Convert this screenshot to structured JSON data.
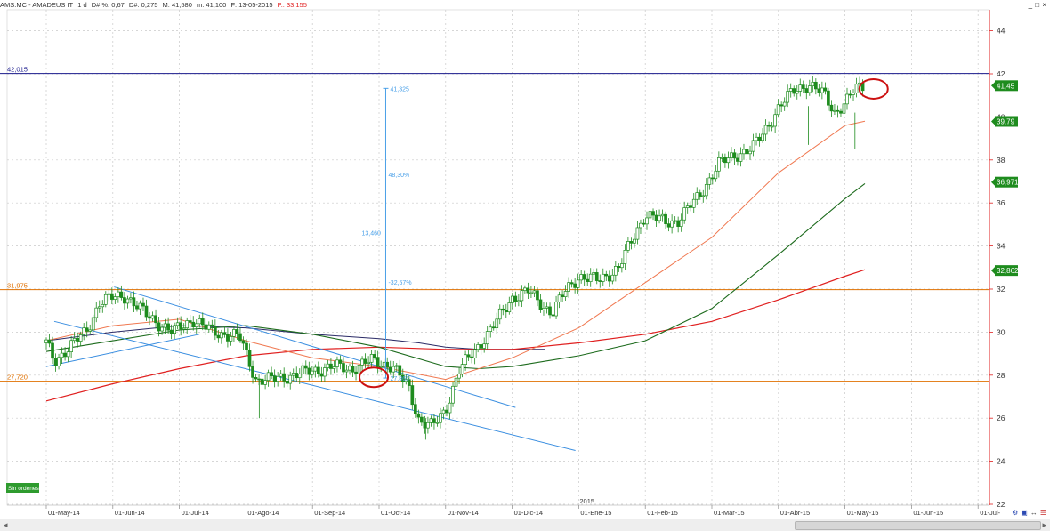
{
  "header": {
    "name": "AMS.MC - AMADEUS IT",
    "interval": "1 d",
    "change_pct": "D# %: 0,67",
    "change_abs": "D#: 0,275",
    "high": "M: 41,580",
    "low": "m: 41,100",
    "date": "F: 13-05-2015",
    "p_value": "P.: 33,155",
    "window_controls": [
      "_",
      "□",
      "×"
    ]
  },
  "chart_data": {
    "type": "candlestick",
    "x": [
      "01-May-14",
      "01-Jun-14",
      "01-Jul-14",
      "01-Ago-14",
      "01-Sep-14",
      "01-Oct-14",
      "01-Nov-14",
      "01-Dic-14",
      "01-Ene-15",
      "01-Feb-15",
      "01-Mar-15",
      "01-Abr-15",
      "01-May-15",
      "01-Jun-15",
      "01-Jul-"
    ],
    "year_marker": "2015",
    "y_ticks": [
      22,
      24,
      26,
      28,
      30,
      32,
      34,
      36,
      38,
      40,
      42,
      44
    ],
    "ylim": [
      22,
      45
    ],
    "price_path": [
      [
        0,
        29.5
      ],
      [
        0.12,
        28.6
      ],
      [
        0.3,
        29.2
      ],
      [
        0.6,
        30.0
      ],
      [
        0.8,
        31.4
      ],
      [
        1.0,
        31.6
      ],
      [
        1.2,
        31.7
      ],
      [
        1.5,
        30.8
      ],
      [
        1.9,
        30.0
      ],
      [
        2.2,
        30.6
      ],
      [
        2.5,
        30.0
      ],
      [
        2.9,
        29.8
      ],
      [
        3.15,
        27.8
      ],
      [
        3.4,
        27.8
      ],
      [
        3.7,
        28.0
      ],
      [
        4.0,
        28.2
      ],
      [
        4.3,
        28.4
      ],
      [
        4.6,
        28.3
      ],
      [
        4.9,
        28.7
      ],
      [
        5.2,
        28.4
      ],
      [
        5.45,
        27.4
      ],
      [
        5.6,
        25.9
      ],
      [
        5.8,
        25.6
      ],
      [
        6.0,
        26.4
      ],
      [
        6.2,
        28.2
      ],
      [
        6.4,
        29.0
      ],
      [
        6.7,
        30.2
      ],
      [
        7.0,
        31.6
      ],
      [
        7.25,
        31.9
      ],
      [
        7.4,
        31.4
      ],
      [
        7.6,
        30.9
      ],
      [
        7.8,
        31.9
      ],
      [
        8.0,
        32.6
      ],
      [
        8.3,
        32.4
      ],
      [
        8.6,
        33.0
      ],
      [
        9.0,
        35.5
      ],
      [
        9.3,
        35.1
      ],
      [
        9.5,
        35.2
      ],
      [
        9.8,
        36.3
      ],
      [
        10.1,
        37.8
      ],
      [
        10.4,
        38.3
      ],
      [
        10.6,
        38.5
      ],
      [
        10.8,
        39.4
      ],
      [
        11.0,
        40.4
      ],
      [
        11.25,
        41.3
      ],
      [
        11.45,
        41.5
      ],
      [
        11.7,
        41.0
      ],
      [
        11.85,
        40.2
      ],
      [
        12.05,
        40.8
      ],
      [
        12.15,
        41.3
      ],
      [
        12.27,
        41.45
      ]
    ],
    "sma_short": [
      [
        0,
        29.6
      ],
      [
        1,
        30.3
      ],
      [
        2,
        30.6
      ],
      [
        3,
        29.6
      ],
      [
        4,
        28.8
      ],
      [
        5,
        28.4
      ],
      [
        6,
        27.8
      ],
      [
        7,
        28.8
      ],
      [
        8,
        30.2
      ],
      [
        9,
        32.3
      ],
      [
        10,
        34.4
      ],
      [
        11,
        37.4
      ],
      [
        12,
        39.6
      ],
      [
        12.3,
        39.8
      ]
    ],
    "sma_mid": [
      [
        0,
        29.1
      ],
      [
        1,
        29.6
      ],
      [
        2,
        30.1
      ],
      [
        3,
        30.3
      ],
      [
        4,
        29.9
      ],
      [
        5,
        29.3
      ],
      [
        6,
        28.4
      ],
      [
        6.5,
        28.3
      ],
      [
        7,
        28.4
      ],
      [
        8,
        28.9
      ],
      [
        9,
        29.6
      ],
      [
        10,
        31.1
      ],
      [
        11,
        33.6
      ],
      [
        12,
        36.2
      ],
      [
        12.3,
        36.9
      ]
    ],
    "sma_long": [
      [
        0,
        26.8
      ],
      [
        1,
        27.6
      ],
      [
        2,
        28.3
      ],
      [
        3,
        28.9
      ],
      [
        4,
        29.2
      ],
      [
        5,
        29.3
      ],
      [
        6,
        29.2
      ],
      [
        7,
        29.2
      ],
      [
        8,
        29.5
      ],
      [
        9,
        29.9
      ],
      [
        10,
        30.5
      ],
      [
        11,
        31.5
      ],
      [
        12,
        32.6
      ],
      [
        12.3,
        32.9
      ]
    ],
    "sma_navy": [
      [
        0,
        29.6
      ],
      [
        1,
        30.0
      ],
      [
        2,
        30.3
      ],
      [
        3,
        30.2
      ],
      [
        4,
        29.9
      ],
      [
        5,
        29.7
      ],
      [
        5.6,
        29.5
      ],
      [
        6,
        29.3
      ],
      [
        6.5,
        29.2
      ],
      [
        7,
        29.2
      ],
      [
        7.5,
        29.2
      ]
    ],
    "hlines": [
      {
        "label": "42,015",
        "value": 42.015,
        "color": "#1a1a8c"
      },
      {
        "label": "31,975",
        "value": 31.975,
        "color": "#e07000"
      },
      {
        "label": "27,720",
        "value": 27.72,
        "color": "#e07000"
      }
    ],
    "trendlines": [
      {
        "x1": 1.02,
        "y1": 32.1,
        "x2": 7.05,
        "y2": 26.5
      },
      {
        "x1": 0.12,
        "y1": 30.5,
        "x2": 7.95,
        "y2": 24.5
      },
      {
        "x1": 0,
        "y1": 28.4,
        "x2": 2.3,
        "y2": 29.9
      }
    ],
    "measurement": {
      "x": 5.1,
      "y_top": 41.325,
      "y_bottom": 27.865,
      "top_label": "41,325",
      "pct_label": "48,30%",
      "diff_label": "13,460",
      "neg_pct_label": "-32,57%",
      "bottom_label": "27,865"
    },
    "price_badges": [
      {
        "label": "41,45",
        "value": 41.45,
        "bg": "#1e8c1e"
      },
      {
        "label": "39,79",
        "value": 39.79,
        "bg": "#1e8c1e"
      },
      {
        "label": "36,971",
        "value": 36.971,
        "bg": "#1e8c1e"
      },
      {
        "label": "32,862",
        "value": 32.862,
        "bg": "#1e8c1e"
      }
    ],
    "circles": [
      {
        "x": 4.92,
        "y": 27.9
      },
      {
        "x": 12.43,
        "y": 41.3
      }
    ],
    "order_badge": "Sin órdenes",
    "colors": {
      "candle": "#1e8c1e",
      "sma_short": "#f07850",
      "sma_mid": "#1d6b1d",
      "sma_long": "#e02020",
      "sma_navy": "#2a2a66",
      "trendline": "#3a8ee0",
      "measure": "#4aa0e8",
      "grid": "#c8c8c8",
      "axis": "#e02020",
      "circle": "#cc1111"
    }
  },
  "toolbar_icons": [
    "settings-icon",
    "save-icon",
    "arrows-icon",
    "menu-icon"
  ]
}
